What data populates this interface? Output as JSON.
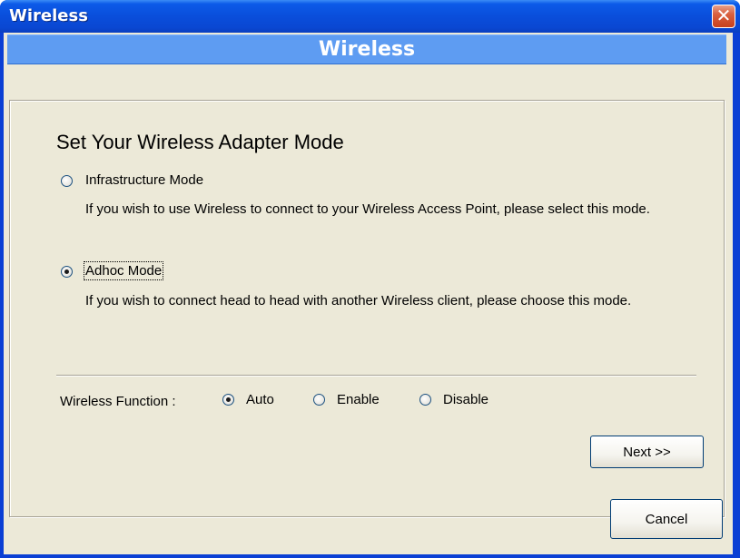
{
  "window": {
    "title": "Wireless"
  },
  "header": {
    "title": "Wireless"
  },
  "main": {
    "heading": "Set Your Wireless Adapter Mode",
    "modes": [
      {
        "label": "Infrastructure Mode",
        "checked": false,
        "description": "If you wish to use Wireless to connect to your Wireless Access Point, please select this mode."
      },
      {
        "label": "Adhoc Mode",
        "checked": true,
        "description": "If you wish to connect head to head with another Wireless client, please choose this mode."
      }
    ],
    "wireless_function": {
      "label": "Wireless Function :",
      "options": [
        {
          "label": "Auto",
          "checked": true
        },
        {
          "label": "Enable",
          "checked": false
        },
        {
          "label": "Disable",
          "checked": false
        }
      ]
    },
    "next_label": "Next >>"
  },
  "footer": {
    "cancel_label": "Cancel"
  },
  "icons": {
    "close": "close-icon"
  },
  "colors": {
    "titlebar": "#0a4edb",
    "header_bar": "#5e9cf2",
    "background": "#ece9d8",
    "close_button": "#d9603f"
  }
}
